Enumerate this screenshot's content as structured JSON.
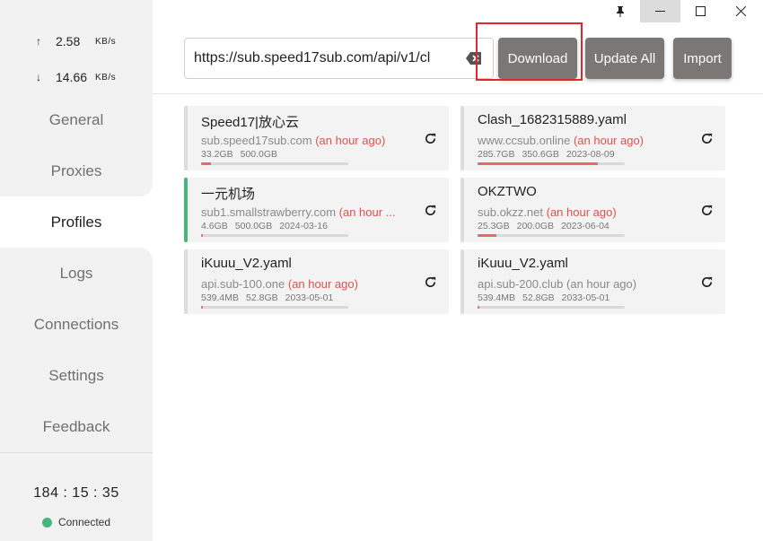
{
  "titlebar": {
    "pin_icon": "pin-icon",
    "minimize_icon": "minimize-icon",
    "maximize_icon": "maximize-icon",
    "close_icon": "close-icon"
  },
  "traffic": {
    "up_arrow": "↑",
    "up_value": "2.58",
    "up_unit": "KB/s",
    "down_arrow": "↓",
    "down_value": "14.66",
    "down_unit": "KB/s"
  },
  "nav": {
    "items": [
      {
        "label": "General"
      },
      {
        "label": "Proxies"
      },
      {
        "label": "Profiles"
      },
      {
        "label": "Logs"
      },
      {
        "label": "Connections"
      },
      {
        "label": "Settings"
      },
      {
        "label": "Feedback"
      }
    ],
    "active": "Profiles"
  },
  "footer": {
    "clock": "184 : 15 : 35",
    "status": "Connected",
    "status_color": "#47b57e"
  },
  "toolbar": {
    "url_value": "https://sub.speed17sub.com/api/v1/cl",
    "download_label": "Download",
    "update_all_label": "Update All",
    "import_label": "Import",
    "highlight_color": "#e12828"
  },
  "profiles": [
    {
      "title": "Speed17|放心云",
      "host": "sub.speed17sub.com",
      "time": "(an hour ago)",
      "used": "33.2GB",
      "total": "500.0GB",
      "expire": "",
      "usage": 0.066,
      "active": false,
      "time_colored": true
    },
    {
      "title": "Clash_1682315889.yaml",
      "host": "www.ccsub.online",
      "time": "(an hour ago)",
      "used": "285.7GB",
      "total": "350.6GB",
      "expire": "2023-08-09",
      "usage": 0.815,
      "active": false,
      "time_colored": true
    },
    {
      "title": "一元机场",
      "host": "sub1.smallstrawberry.com",
      "time": "(an hour ...",
      "used": "4.6GB",
      "total": "500.0GB",
      "expire": "2024-03-16",
      "usage": 0.009,
      "active": true,
      "time_colored": true
    },
    {
      "title": "OKZTWO",
      "host": "sub.okzz.net",
      "time": "(an hour ago)",
      "used": "25.3GB",
      "total": "200.0GB",
      "expire": "2023-06-04",
      "usage": 0.127,
      "active": false,
      "time_colored": true
    },
    {
      "title": "iKuuu_V2.yaml",
      "host": "api.sub-100.one",
      "time": "(an hour ago)",
      "used": "539.4MB",
      "total": "52.8GB",
      "expire": "2033-05-01",
      "usage": 0.01,
      "active": false,
      "time_colored": true
    },
    {
      "title": "iKuuu_V2.yaml",
      "host": "api.sub-200.club",
      "time": "(an hour ago)",
      "used": "539.4MB",
      "total": "52.8GB",
      "expire": "2033-05-01",
      "usage": 0.01,
      "active": false,
      "time_colored": false
    }
  ]
}
